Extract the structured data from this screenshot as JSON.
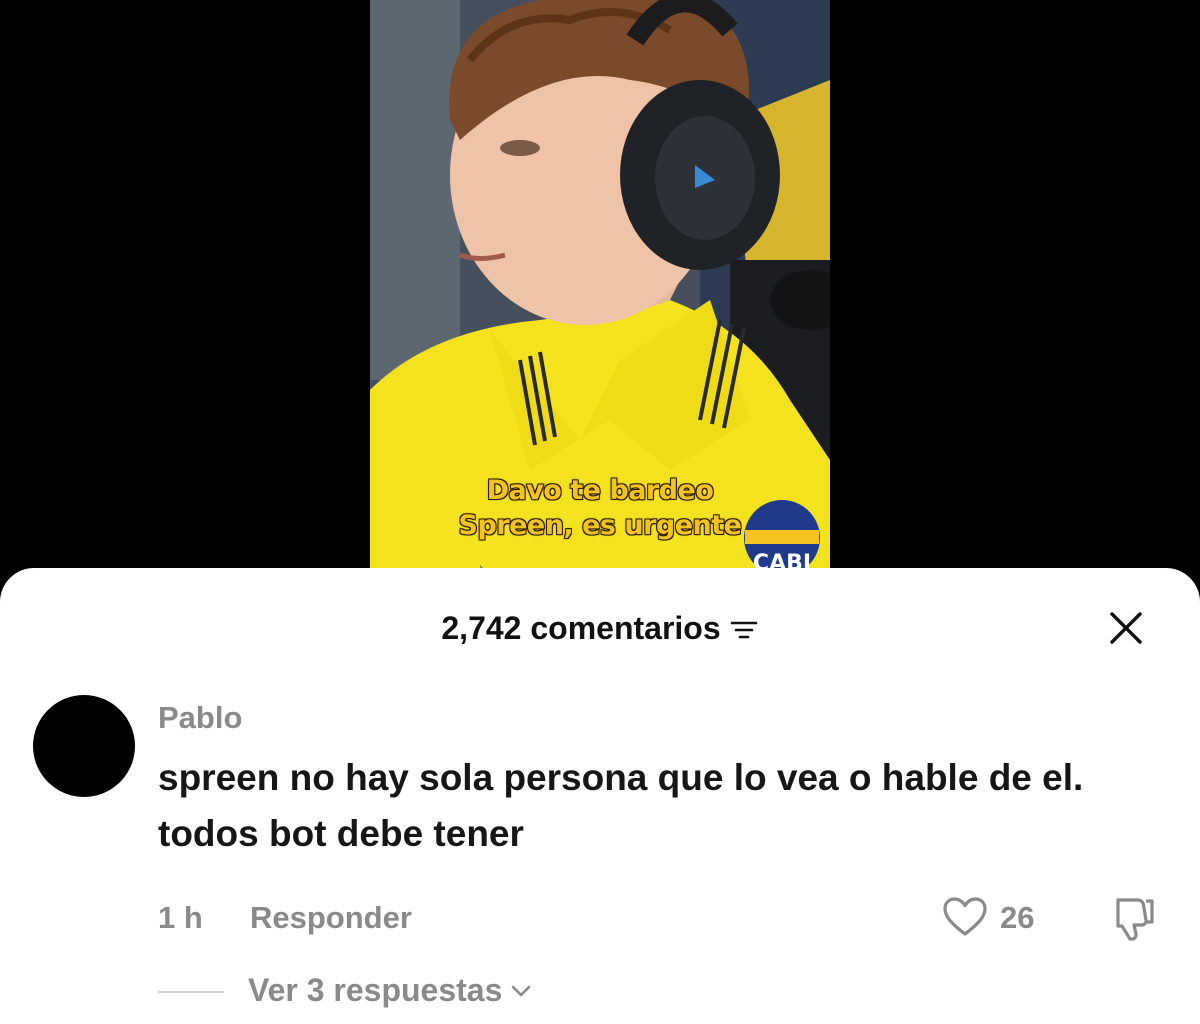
{
  "video": {
    "caption_line1": "Davo te bardeo",
    "caption_line2": "Spreen, es urgente",
    "badge_text": "CABJ",
    "shirt_color": "#f4e21f",
    "caption_color": "#f4c320"
  },
  "comments_sheet": {
    "title": "2,742 comentarios",
    "sort_icon": "sort-lines-icon",
    "close_icon": "close-icon"
  },
  "comment": {
    "username": "Pablo",
    "text": "spreen no hay sola persona que lo vea o hable de el. todos bot debe tener",
    "time": "1 h",
    "reply_label": "Responder",
    "like_count": "26",
    "view_replies": "Ver 3 respuestas"
  }
}
